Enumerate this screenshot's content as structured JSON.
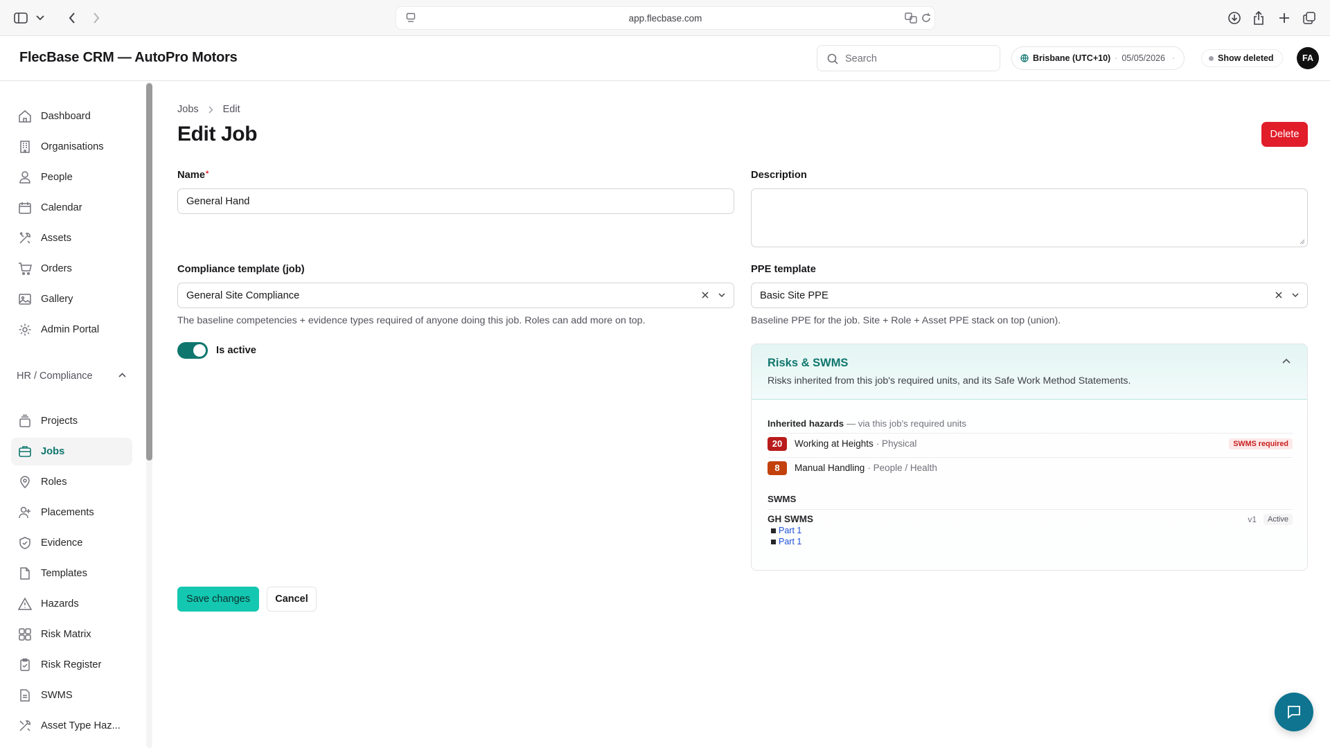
{
  "browser": {
    "url": "app.flecbase.com"
  },
  "header": {
    "brand": "FlecBase CRM — AutoPro Motors",
    "search_placeholder": "Search",
    "timezone": "Brisbane (UTC+10)",
    "date": "05/05/2026",
    "show_deleted": "Show deleted",
    "avatar_initials": "FA"
  },
  "sidebar": {
    "items": [
      {
        "label": "Dashboard",
        "icon": "home-icon"
      },
      {
        "label": "Organisations",
        "icon": "building-icon"
      },
      {
        "label": "People",
        "icon": "user-icon"
      },
      {
        "label": "Calendar",
        "icon": "calendar-icon"
      },
      {
        "label": "Assets",
        "icon": "tools-icon"
      },
      {
        "label": "Orders",
        "icon": "cart-icon"
      },
      {
        "label": "Gallery",
        "icon": "image-icon"
      },
      {
        "label": "Admin Portal",
        "icon": "gear-icon"
      }
    ],
    "group_label": "HR / Compliance",
    "group_items": [
      {
        "label": "Projects",
        "icon": "stack-icon"
      },
      {
        "label": "Jobs",
        "icon": "briefcase-icon",
        "active": true
      },
      {
        "label": "Roles",
        "icon": "pin-icon"
      },
      {
        "label": "Placements",
        "icon": "user-plus-icon"
      },
      {
        "label": "Evidence",
        "icon": "shield-check-icon"
      },
      {
        "label": "Templates",
        "icon": "file-icon"
      },
      {
        "label": "Hazards",
        "icon": "warning-icon"
      },
      {
        "label": "Risk Matrix",
        "icon": "grid-icon"
      },
      {
        "label": "Risk Register",
        "icon": "clipboard-icon"
      },
      {
        "label": "SWMS",
        "icon": "document-icon"
      },
      {
        "label": "Asset Type Haz...",
        "icon": "tools-icon"
      }
    ]
  },
  "page": {
    "breadcrumb": [
      "Jobs",
      "Edit"
    ],
    "title": "Edit Job",
    "delete_label": "Delete"
  },
  "form": {
    "name_label": "Name",
    "name_required_mark": "*",
    "name_value": "General Hand",
    "description_label": "Description",
    "description_value": "",
    "compliance_label": "Compliance template (job)",
    "compliance_value": "General Site Compliance",
    "compliance_help": "The baseline competencies + evidence types required of anyone doing this job. Roles can add more on top.",
    "ppe_label": "PPE template",
    "ppe_value": "Basic Site PPE",
    "ppe_help": "Baseline PPE for the job. Site + Role + Asset PPE stack on top (union).",
    "active_label": "Is active",
    "active": true,
    "save_label": "Save changes",
    "cancel_label": "Cancel"
  },
  "risks": {
    "title": "Risks & SWMS",
    "subtitle": "Risks inherited from this job's required units, and its Safe Work Method Statements.",
    "inherited_heading": "Inherited hazards",
    "inherited_note": "— via this job's required units",
    "hazards": [
      {
        "score": "20",
        "name": "Working at Heights",
        "category": "· Physical",
        "badge": "SWMS required"
      },
      {
        "score": "8",
        "name": "Manual Handling",
        "category": "· People / Health",
        "badge": ""
      }
    ],
    "swms_heading": "SWMS",
    "swms": [
      {
        "name": "GH SWMS",
        "version": "v1",
        "status": "Active",
        "parts": [
          "Part 1",
          "Part 1"
        ]
      }
    ]
  },
  "colors": {
    "accent": "#0f766e",
    "danger": "#e11d2a",
    "save": "#14c7b1"
  }
}
